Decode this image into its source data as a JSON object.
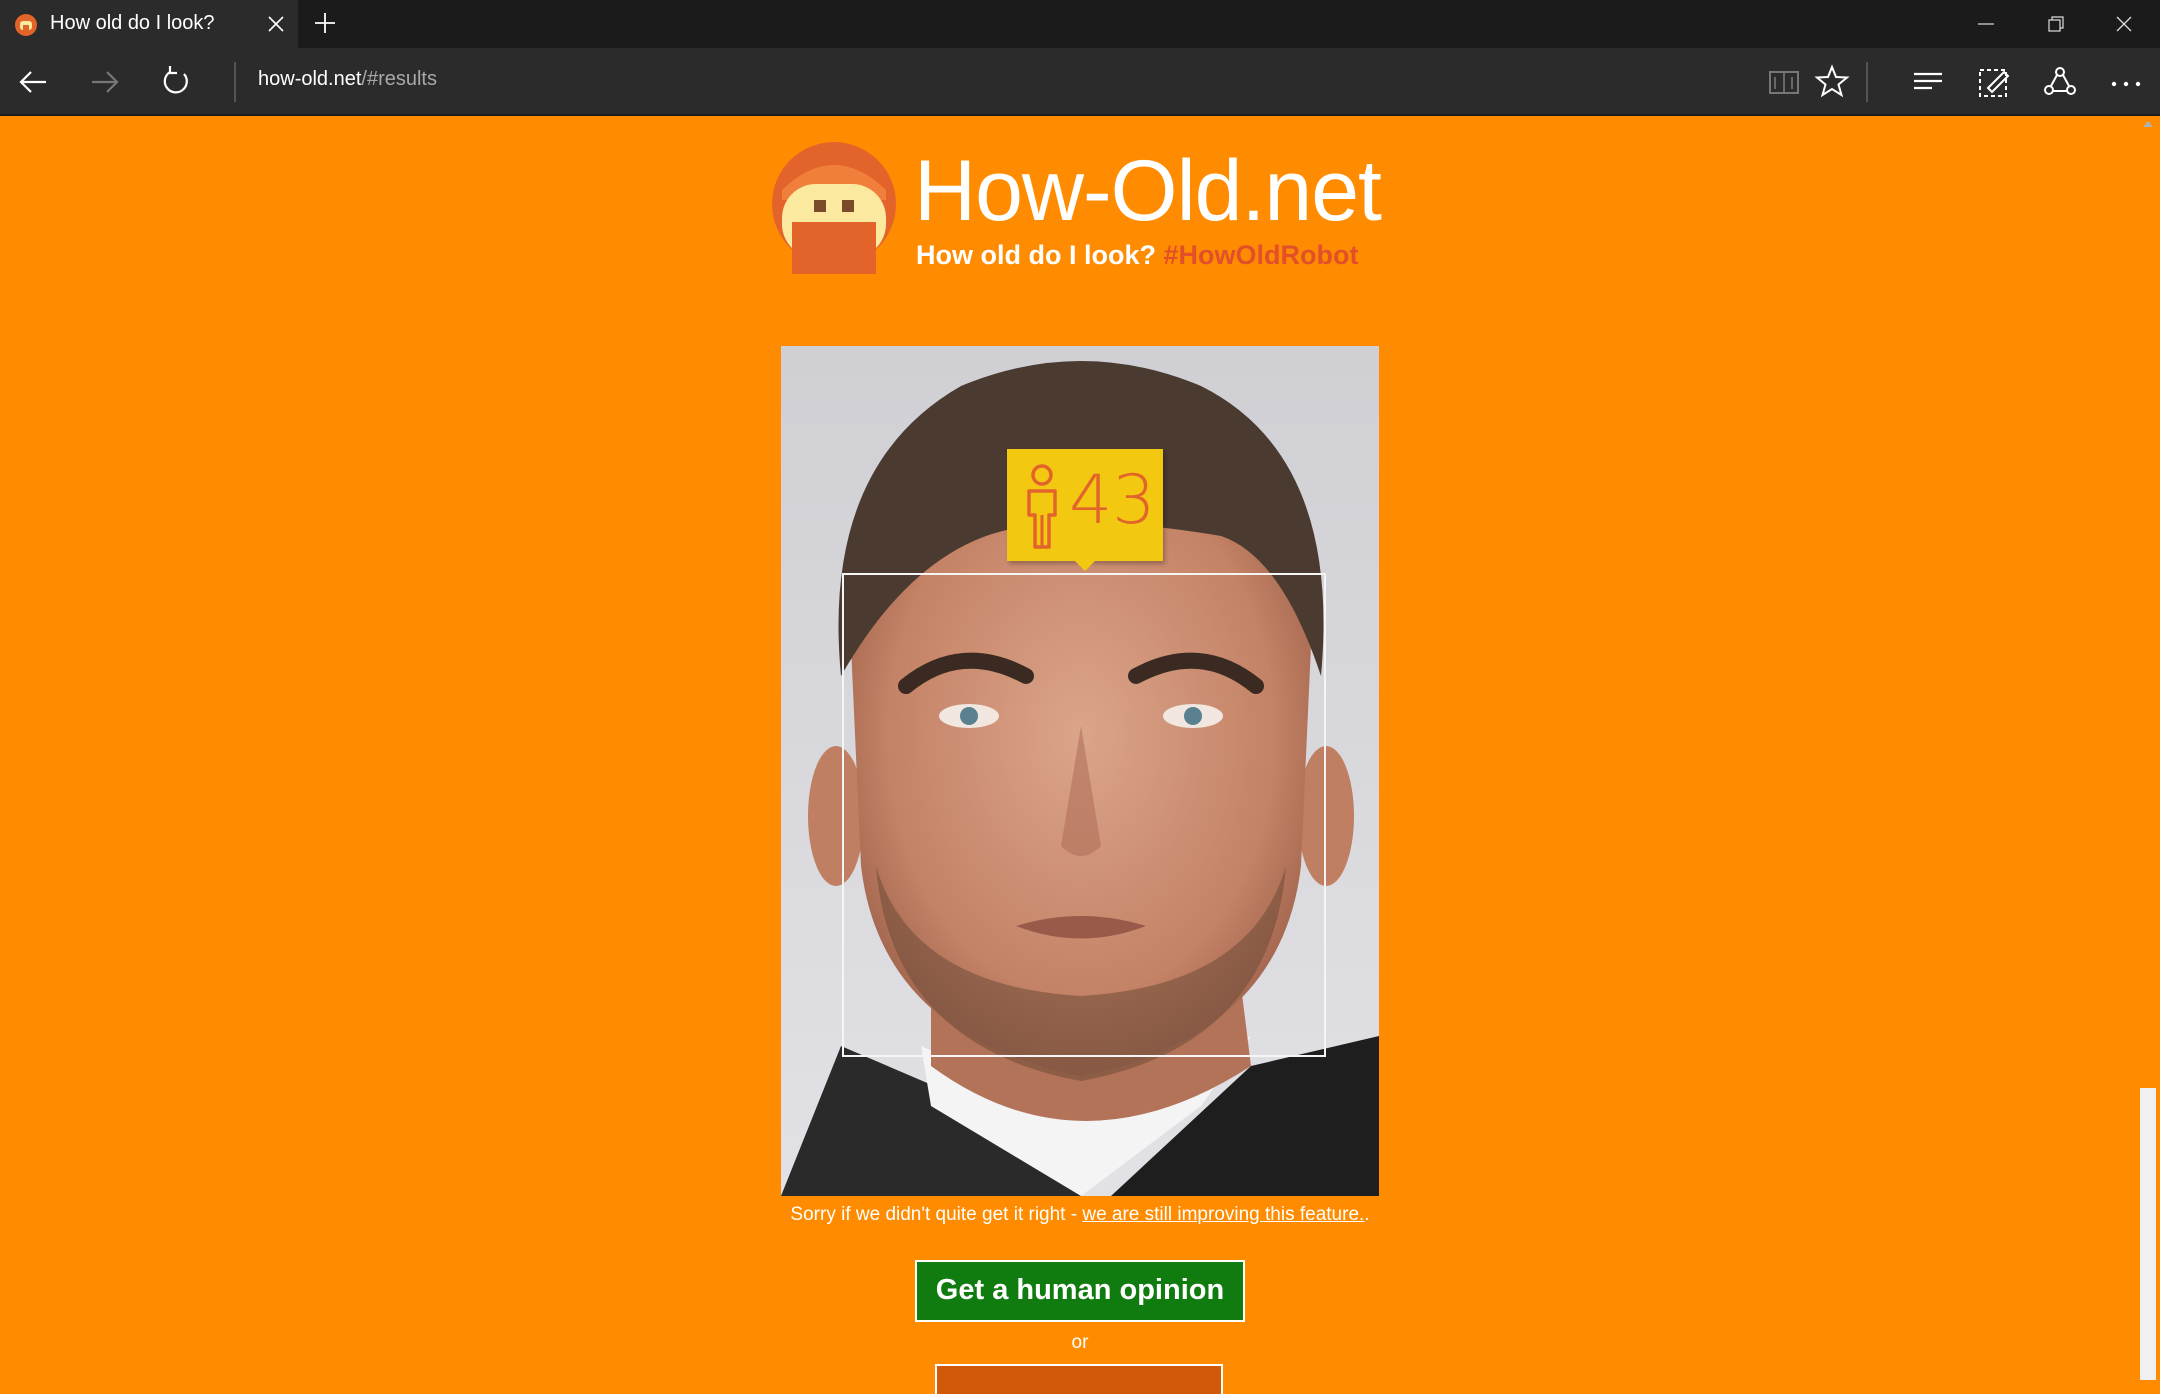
{
  "browser": {
    "tab": {
      "title": "How old do I look?",
      "favicon": "how-old-robot-favicon"
    },
    "address": {
      "host": "how-old.net",
      "path": "/#results"
    },
    "toolbar_icons": [
      "back-icon",
      "forward-icon",
      "refresh-icon",
      "reading-view-icon",
      "favorite-star-icon",
      "hub-icon",
      "web-note-icon",
      "share-icon",
      "more-icon"
    ],
    "window_icons": [
      "minimize-icon",
      "restore-icon",
      "close-icon"
    ]
  },
  "site": {
    "title": "How-Old.net",
    "tagline": "How old do I look?",
    "hashtag": "#HowOldRobot"
  },
  "result": {
    "age": "43",
    "gender_icon": "male-person-icon"
  },
  "disclaimer": {
    "text": "Sorry if we didn't quite get it right - ",
    "link": "we are still improving this feature.",
    "suffix": "."
  },
  "actions": {
    "human_opinion": "Get a human opinion",
    "or": "or"
  },
  "colors": {
    "page_background": "#FF8C00",
    "badge": "#F2C811",
    "age_text": "#E3642A",
    "human_button": "#107C10",
    "hashtag": "#E2502A"
  }
}
